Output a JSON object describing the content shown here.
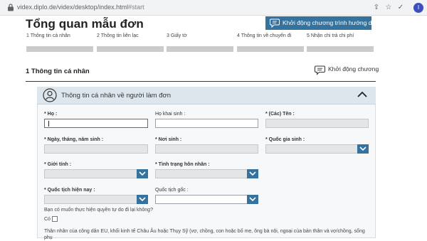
{
  "browser": {
    "url_main": "videx.diplo.de/videx/desktop/index.html",
    "url_hash": "#start",
    "profile_initial": "I"
  },
  "header": {
    "title": "Tổng quan mẫu đơn",
    "guide_button": "Khởi động chương trình hướng dẫn"
  },
  "steps": [
    {
      "label": "1 Thông tin cá nhân"
    },
    {
      "label": "2 Thông tin liên lạc"
    },
    {
      "label": "3 Giấy tờ"
    },
    {
      "label": "4 Thông tin về chuyến đi"
    },
    {
      "label": "5 Nhận chi trả chi phí"
    }
  ],
  "section": {
    "title": "1 Thông tin cá nhân",
    "guide_link": "Khởi động chương"
  },
  "panel": {
    "title": "Thông tin cá nhân về người làm đơn",
    "fields": {
      "surname": {
        "required": "* ",
        "label": "Họ :",
        "value": ""
      },
      "birth_name": {
        "required": "",
        "label": "Họ khai sinh :",
        "value": ""
      },
      "given_names": {
        "required": "* ",
        "label": "(Các) Tên :",
        "value": ""
      },
      "dob": {
        "required": "* ",
        "label": "Ngày, tháng, năm sinh :",
        "value": ""
      },
      "birthplace": {
        "required": "* ",
        "label": "Nơi sinh :",
        "value": ""
      },
      "birth_country": {
        "required": "* ",
        "label": "Quốc gia sinh :",
        "value": ""
      },
      "gender": {
        "required": "* ",
        "label": "Giới tính :",
        "value": ""
      },
      "marital_status": {
        "required": "* ",
        "label": "Tình trạng hôn nhân :",
        "value": ""
      },
      "current_nationality": {
        "required": "* ",
        "label": "Quốc tịch hiện nay :",
        "value": ""
      },
      "origin_nationality": {
        "required": "",
        "label": "Quốc tịch gốc :",
        "value": ""
      }
    },
    "question": "Bạn có muốn thực hiện quyền tự do đi lại không?",
    "checkbox_label": "Có",
    "checkbox_checked": false,
    "paragraph": "Thân nhân của công dân EU, khối kinh tế Châu Âu hoặc Thụy Sỹ (vợ, chồng, con hoặc bố mẹ, ông bà nội, ngoại của bản thân và vợ/chồng, sống phụ"
  },
  "colors": {
    "accent": "#35739e",
    "panel_header": "#dde5ed",
    "step_bar": "#c9cbcc"
  }
}
